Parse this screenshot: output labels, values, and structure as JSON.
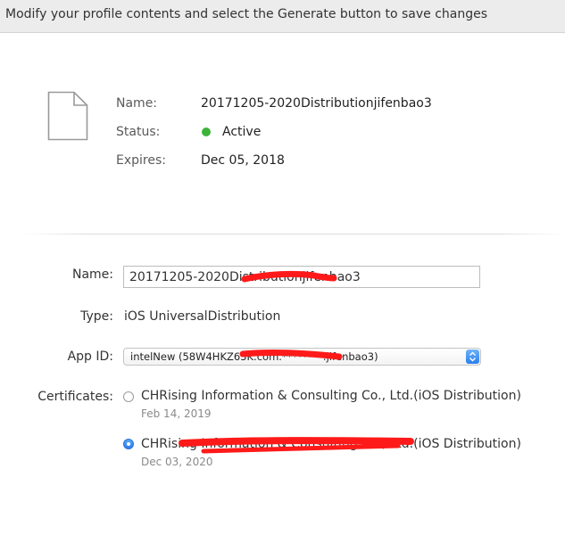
{
  "header": {
    "instruction": "Modify your profile contents and select the Generate button to save changes"
  },
  "summary": {
    "icon": "document-icon",
    "name_label": "Name:",
    "name_value": "20171205-2020Distributionjifenbao3",
    "status_label": "Status:",
    "status_value": "Active",
    "status_color": "#3db33a",
    "expires_label": "Expires:",
    "expires_value": "Dec 05, 2018"
  },
  "form": {
    "name_label": "Name:",
    "name_value": "20171205-2020Distributionjifenbao3",
    "type_label": "Type:",
    "type_value": "iOS UniversalDistribution",
    "appid_label": "App ID:",
    "appid_value": "intelNew (58W4HKZ65K.com.********.jifenbao3)",
    "certificates_label": "Certificates:",
    "certificates": [
      {
        "name": "CHRising Information & Consulting Co., Ltd.(iOS Distribution)",
        "date": "Feb 14, 2019",
        "selected": false
      },
      {
        "name": "CHRising Information & Consulting Co., Ltd.(iOS Distribution)",
        "date": "Dec 03, 2020",
        "selected": true
      }
    ]
  },
  "colors": {
    "accent": "#2a7ef0",
    "redaction": "#ff1a1a"
  }
}
